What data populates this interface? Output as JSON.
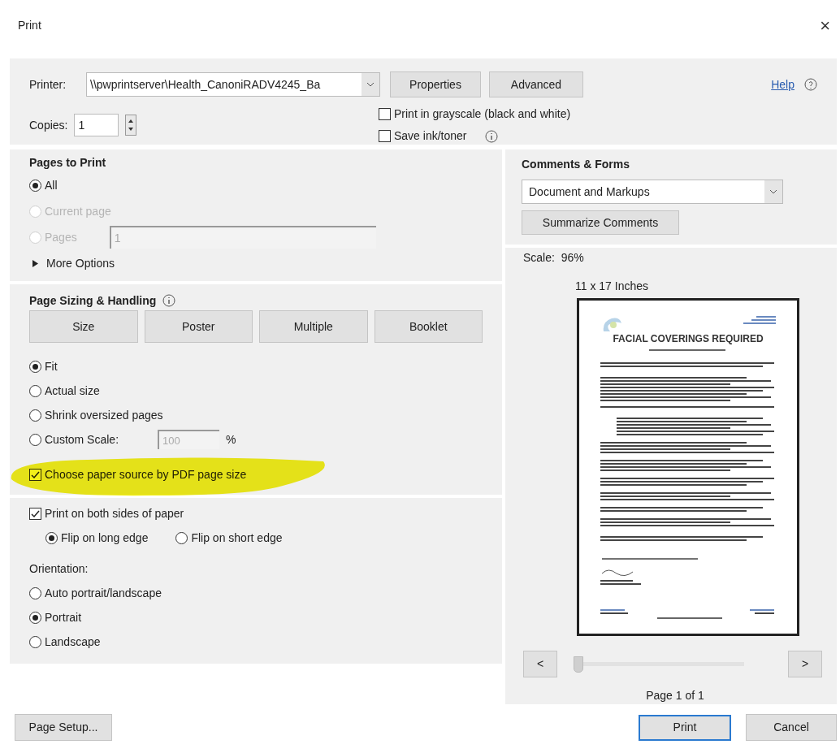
{
  "window": {
    "title": "Print",
    "close": "×"
  },
  "printer": {
    "label": "Printer:",
    "value": "\\\\pwprintserver\\Health_CanoniRADV4245_Ba"
  },
  "top_buttons": [
    "Properties",
    "Advanced"
  ],
  "help": "Help",
  "copies": {
    "label": "Copies:",
    "value": "1"
  },
  "print_options": [
    {
      "label": "Print in grayscale (black and white)",
      "checked": false,
      "info": false
    },
    {
      "label": "Save ink/toner",
      "checked": false,
      "info": true
    }
  ],
  "pages_to_print": {
    "title": "Pages to Print",
    "radios": [
      {
        "label": "All",
        "selected": true,
        "disabled": false
      },
      {
        "label": "Current page",
        "selected": false,
        "disabled": true
      },
      {
        "label": "Pages",
        "selected": false,
        "disabled": true
      }
    ],
    "pages_value": "1",
    "more_options": "More Options"
  },
  "sizing": {
    "title": "Page Sizing & Handling",
    "tabs": [
      "Size",
      "Poster",
      "Multiple",
      "Booklet"
    ],
    "radios": [
      {
        "label": "Fit",
        "selected": true
      },
      {
        "label": "Actual size",
        "selected": false
      },
      {
        "label": "Shrink oversized pages",
        "selected": false
      },
      {
        "label": "Custom Scale:",
        "selected": false
      }
    ],
    "scale_value": "100",
    "scale_unit": "%",
    "paper_source": {
      "label": "Choose paper source by PDF page size",
      "checked": true
    }
  },
  "duplex": {
    "label": "Print on both sides of paper",
    "checked": true,
    "radios": [
      {
        "label": "Flip on long edge",
        "selected": true
      },
      {
        "label": "Flip on short edge",
        "selected": false
      }
    ]
  },
  "orientation": {
    "label": "Orientation:",
    "radios": [
      {
        "label": "Auto portrait/landscape",
        "selected": false
      },
      {
        "label": "Portrait",
        "selected": true
      },
      {
        "label": "Landscape",
        "selected": false
      }
    ]
  },
  "comments_forms": {
    "title": "Comments & Forms",
    "value": "Document and Markups",
    "button": "Summarize Comments"
  },
  "preview": {
    "scale": "Scale:  96%",
    "paper": "11 x 17 Inches",
    "heading": "FACIAL COVERINGS REQUIRED",
    "prev": "<",
    "next": ">",
    "slider": {
      "level": 0
    },
    "page": "Page 1 of 1"
  },
  "bottom_buttons": {
    "setup": "Page Setup...",
    "print": "Print",
    "cancel": "Cancel"
  }
}
